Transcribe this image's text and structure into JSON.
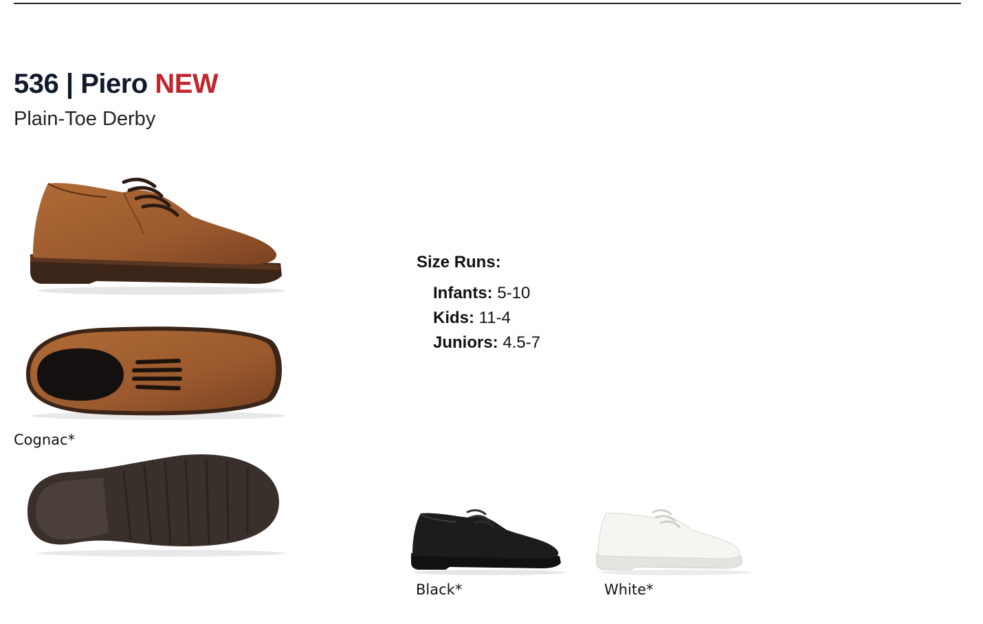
{
  "header": {
    "style_number": "536",
    "separator": "|",
    "style_name": "Piero",
    "badge": "NEW",
    "subtitle": "Plain-Toe Derby"
  },
  "colors": {
    "title": "#111a2c",
    "badge": "#c0262d",
    "cognac": "#9a5a2e",
    "black": "#1c1c1c",
    "white": "#f2f2ee",
    "sole": "#3a302b"
  },
  "products": {
    "main_color_label": "Cognac*",
    "variants": [
      {
        "label": "Black*"
      },
      {
        "label": "White*"
      }
    ]
  },
  "size_runs": {
    "title": "Size Runs:",
    "rows": [
      {
        "name": "Infants:",
        "range": "5-10"
      },
      {
        "name": "Kids:",
        "range": "11-4"
      },
      {
        "name": "Juniors:",
        "range": "4.5-7"
      }
    ]
  }
}
